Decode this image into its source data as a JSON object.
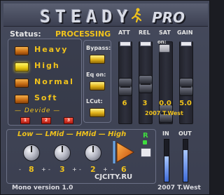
{
  "header": {
    "title": "STEADY",
    "edition": "PRO"
  },
  "status": {
    "label": "Status:",
    "value": "PROCESSING"
  },
  "modes": [
    {
      "label": "Heavy",
      "active": false
    },
    {
      "label": "High",
      "active": true
    },
    {
      "label": "Normal",
      "active": false
    },
    {
      "label": "Soft",
      "active": false
    }
  ],
  "divide": {
    "label": "Devide",
    "buttons": [
      "1",
      "2",
      "3"
    ]
  },
  "switches": {
    "bypass_label": "Bypass:",
    "eq_label": "Eq on:",
    "lcut_label": "LCut:"
  },
  "sliders": [
    {
      "label": "ATT",
      "value": "6",
      "level": 0.45
    },
    {
      "label": "REL",
      "value": "3",
      "level": 0.5
    },
    {
      "label": "SAT",
      "value": "0.0",
      "level": 0.0
    },
    {
      "label": "GAIN",
      "value": "5.0",
      "level": 0.45
    }
  ],
  "sat_switch": {
    "label": "on:"
  },
  "credit": "2007 T.West",
  "bands": {
    "label": "Low — LMid — HMid — High",
    "values": [
      "8",
      "3",
      "2",
      "6"
    ]
  },
  "r_toggle": {
    "label": "R"
  },
  "meters": {
    "in_label": "IN",
    "out_label": "OUT",
    "in_level": 0.6,
    "out_level": 0.75
  },
  "footer": {
    "version": "Mono version 1.0",
    "watermark": "CJCITY.RU"
  },
  "colors": {
    "accent": "#f0c21c",
    "panel": "#454a5c",
    "led_on": "#e8c814"
  }
}
